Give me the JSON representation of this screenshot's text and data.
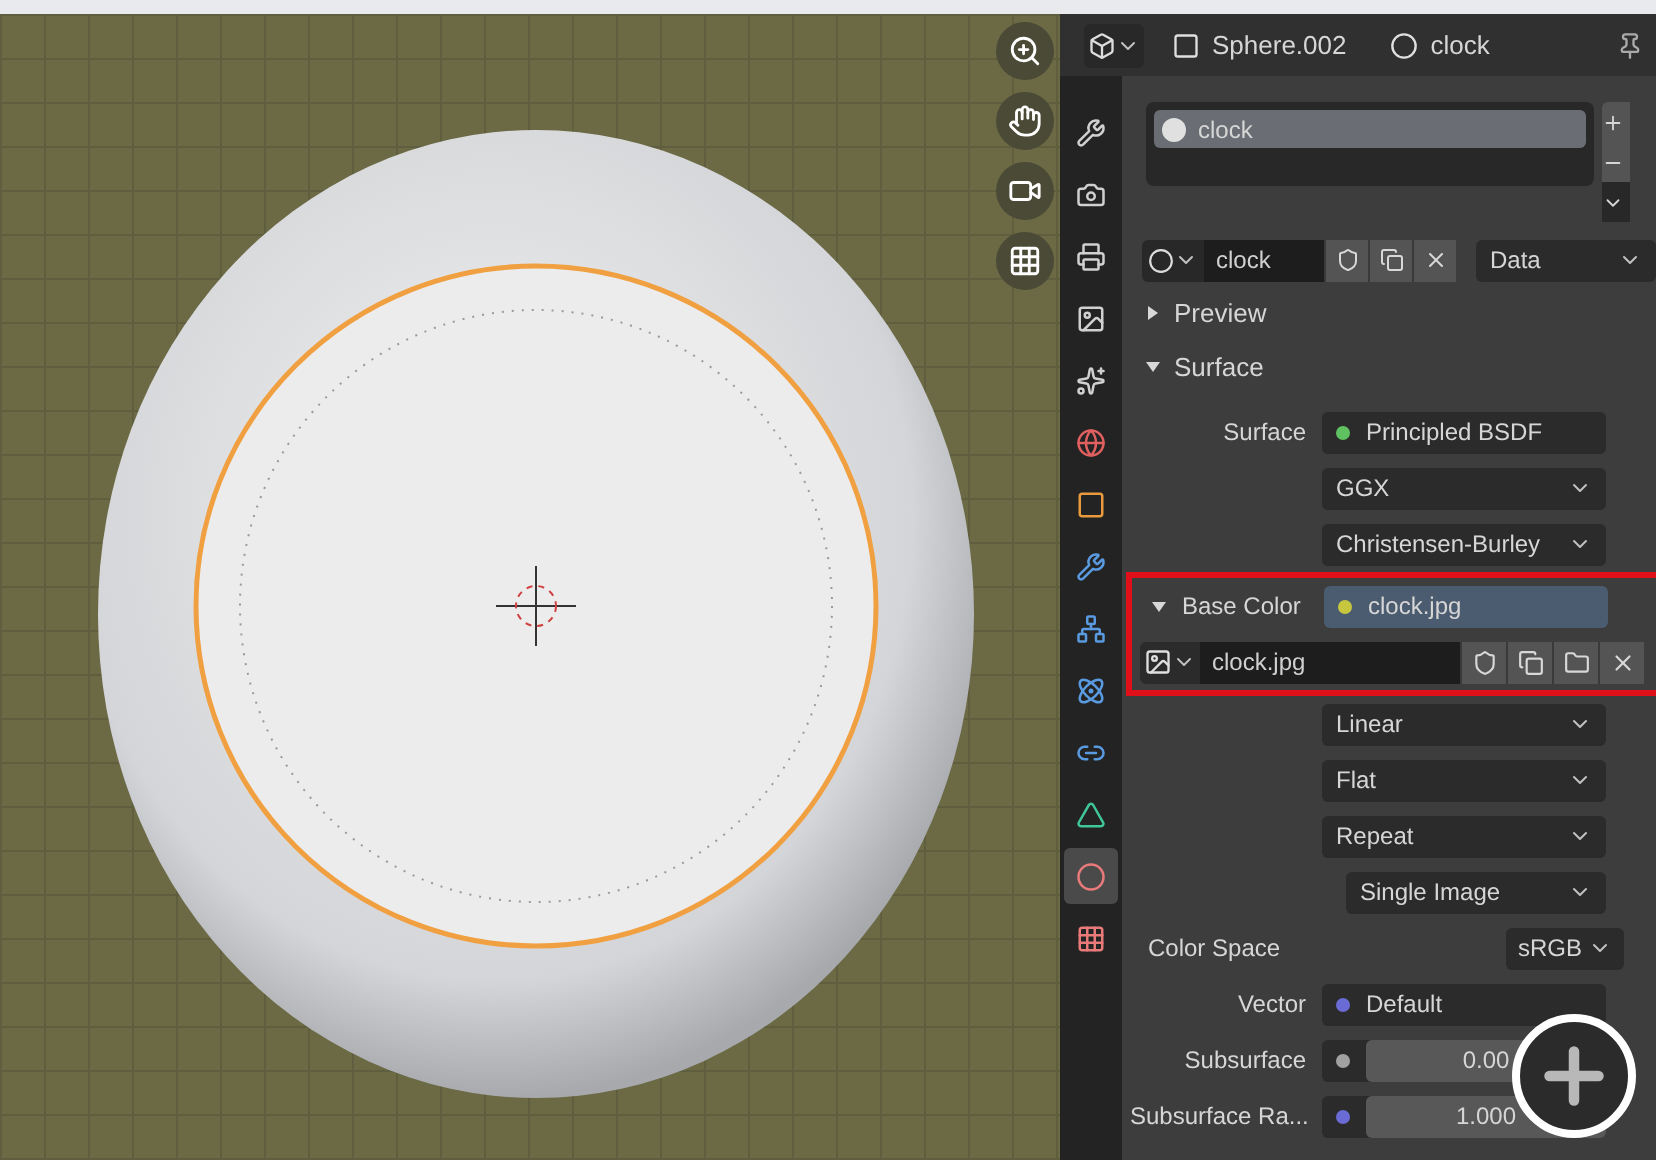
{
  "header": {
    "object": "Sphere.002",
    "material": "clock"
  },
  "tabs": [
    {
      "selected": false
    },
    {
      "selected": false
    },
    {
      "selected": false
    },
    {
      "selected": false
    },
    {
      "selected": false
    },
    {
      "selected": false
    },
    {
      "selected": false
    },
    {
      "selected": false
    },
    {
      "selected": false
    },
    {
      "selected": false
    },
    {
      "selected": false
    },
    {
      "selected": false
    },
    {
      "selected": true
    },
    {
      "selected": false
    }
  ],
  "material_slots": [
    {
      "label": "clock",
      "selected": true
    }
  ],
  "material_datablock": {
    "name": "clock",
    "link": "Data"
  },
  "panels": [
    {
      "label": "Preview",
      "expanded": false
    },
    {
      "label": "Surface",
      "expanded": true
    }
  ],
  "properties": [
    {
      "kind": "socket",
      "label": "Surface",
      "value": "Principled BSDF",
      "color": "#5fc15f",
      "highlighted": false
    },
    {
      "kind": "dropdown",
      "value": "GGX",
      "highlighted": false
    },
    {
      "kind": "dropdown",
      "value": "Christensen-Burley",
      "highlighted": false
    },
    {
      "kind": "socket",
      "label": "Base Color",
      "value": "clock.jpg",
      "color": "#c7c73f",
      "expanded": true,
      "highlighted": true
    },
    {
      "kind": "image",
      "value": "clock.jpg",
      "highlighted": true
    },
    {
      "kind": "dropdown",
      "value": "Linear",
      "highlighted": false
    },
    {
      "kind": "dropdown",
      "value": "Flat",
      "highlighted": false
    },
    {
      "kind": "dropdown",
      "value": "Repeat",
      "highlighted": false
    },
    {
      "kind": "dropdown",
      "value": "Single Image",
      "indent": true,
      "highlighted": false
    },
    {
      "kind": "enum",
      "label": "Color Space",
      "value": "sRGB",
      "highlighted": false
    },
    {
      "kind": "socket",
      "label": "Vector",
      "value": "Default",
      "color": "#6b6bd6",
      "highlighted": false
    },
    {
      "kind": "number",
      "label": "Subsurface",
      "value": "0.00",
      "color": "#a1a1a1",
      "highlighted": false
    },
    {
      "kind": "number",
      "label": "Subsurface Ra...",
      "value": "1.000",
      "color": "#6b6bd6",
      "highlighted": false
    }
  ]
}
